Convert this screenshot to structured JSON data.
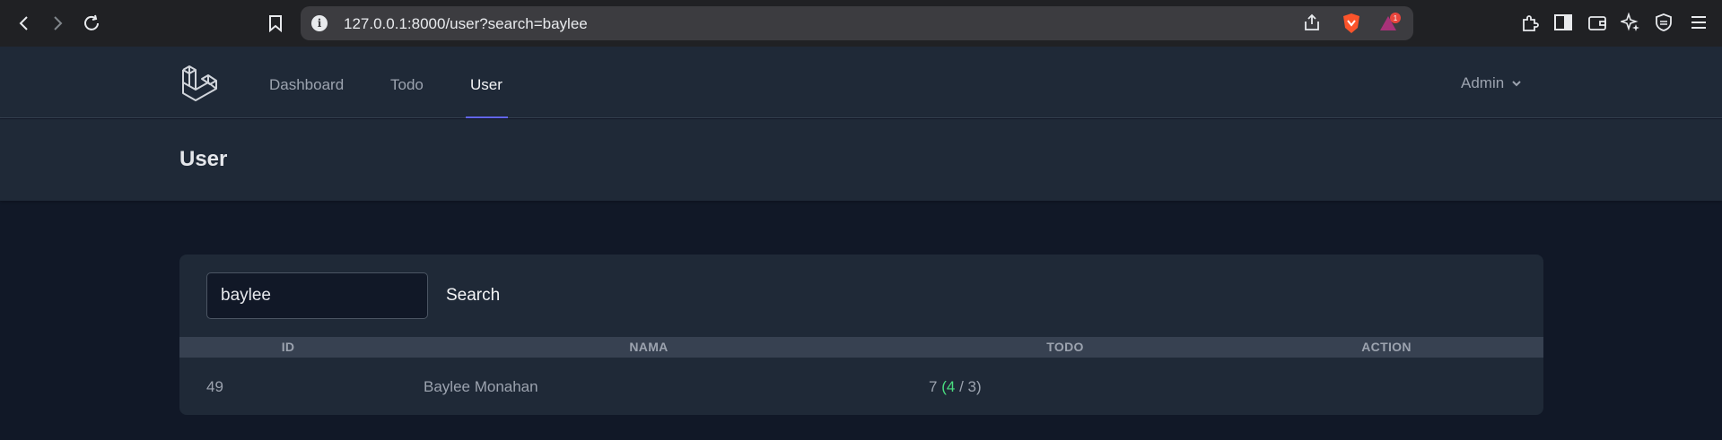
{
  "browser": {
    "url": "127.0.0.1:8000/user?search=baylee",
    "notification_count": "1"
  },
  "nav": {
    "links": [
      {
        "label": "Dashboard"
      },
      {
        "label": "Todo"
      },
      {
        "label": "User"
      }
    ],
    "user_menu": "Admin"
  },
  "page": {
    "title": "User"
  },
  "search": {
    "value": "baylee",
    "button_label": "Search"
  },
  "table": {
    "columns": [
      "ID",
      "NAMA",
      "TODO",
      "ACTION"
    ],
    "rows": [
      {
        "id": "49",
        "nama": "Baylee Monahan",
        "todo_total": "7",
        "todo_done": "4",
        "todo_pending": "3"
      }
    ]
  },
  "colors": {
    "accent": "#6366f1",
    "done": "#4ade80",
    "background": "#111827",
    "surface": "#1f2937"
  }
}
